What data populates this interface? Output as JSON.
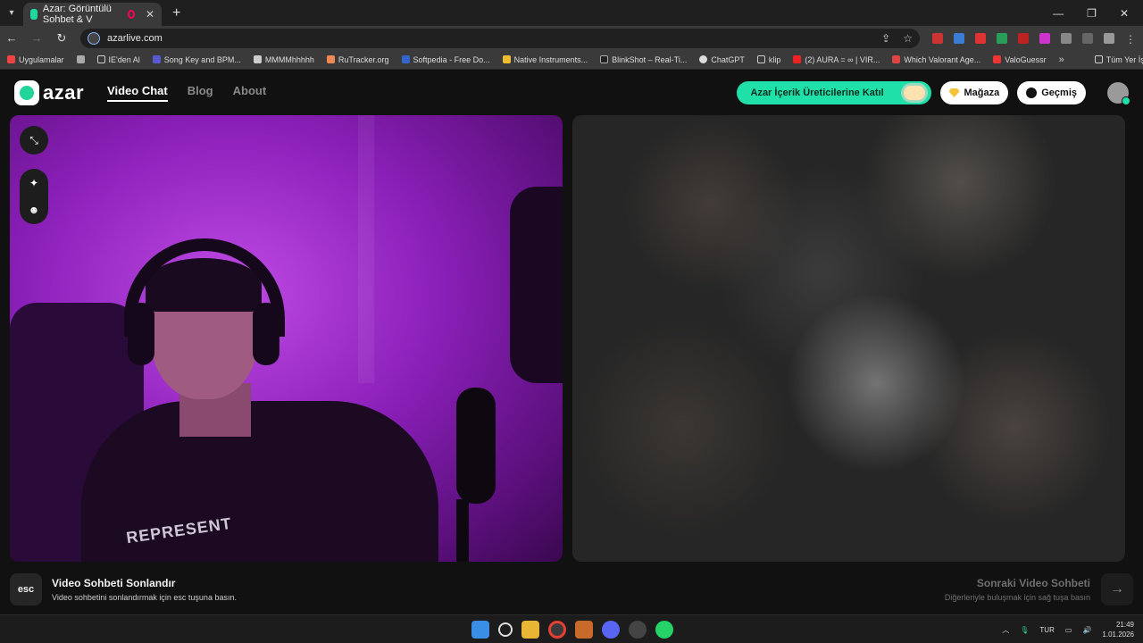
{
  "browser": {
    "tab_title": "Azar: Görüntülü Sohbet & V",
    "url": "azarlive.com",
    "bookmarks": [
      "Uygulamalar",
      "IE'den Al",
      "Song Key and BPM...",
      "MMMMhhhhh",
      "RuTracker.org",
      "Softpedia - Free Do...",
      "Native Instruments...",
      "BlinkShot – Real-Ti...",
      "ChatGPT",
      "klip",
      "(2) AURA = ∞ | VIR...",
      "Which Valorant Age...",
      "ValoGuessr"
    ],
    "bookmarks_more": "»",
    "all_bookmarks": "Tüm Yer İşaretleri"
  },
  "header": {
    "logo": "azar",
    "nav": [
      "Video Chat",
      "Blog",
      "About"
    ],
    "creator_button": "Azar İçerik Üreticilerine Katıl",
    "shop_button": "Mağaza",
    "history_button": "Geçmiş"
  },
  "local_video": {
    "shirt_text": "REPRESENT"
  },
  "bottom": {
    "esc_key": "esc",
    "end_title": "Video Sohbeti Sonlandır",
    "end_subtitle": "Video sohbetini sonlandırmak için esc tuşuna basın.",
    "next_title": "Sonraki Video Sohbeti",
    "next_subtitle": "Diğerleriyle buluşmak için sağ tuşa basın",
    "next_arrow": "→"
  },
  "taskbar": {
    "language": "TUR",
    "time": "21:49",
    "date": "1.01.2026"
  },
  "colors": {
    "accent": "#1fe0a8",
    "local_video_purple": "#9a2ad0"
  }
}
